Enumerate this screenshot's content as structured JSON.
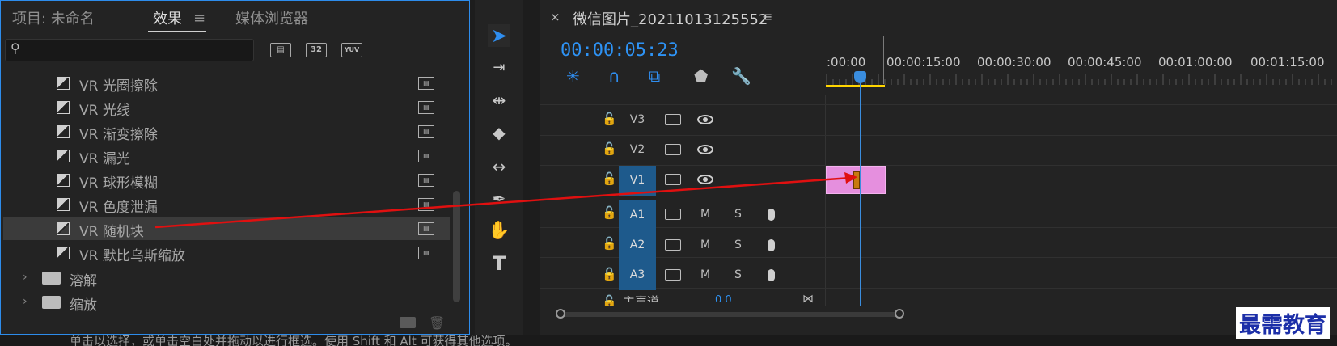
{
  "effects_panel": {
    "tabs": [
      {
        "label": "项目: 未命名"
      },
      {
        "label": "效果"
      },
      {
        "label": "媒体浏览器"
      }
    ],
    "menu_icon": "hamburger-icon",
    "toolbar_badges": [
      "32",
      "YUV"
    ],
    "search": {
      "value": "",
      "placeholder": ""
    },
    "items": [
      {
        "label": "VR 光圈擦除",
        "kind": "effect"
      },
      {
        "label": "VR 光线",
        "kind": "effect"
      },
      {
        "label": "VR 渐变擦除",
        "kind": "effect"
      },
      {
        "label": "VR 漏光",
        "kind": "effect"
      },
      {
        "label": "VR 球形模糊",
        "kind": "effect"
      },
      {
        "label": "VR 色度泄漏",
        "kind": "effect"
      },
      {
        "label": "VR 随机块",
        "kind": "effect",
        "selected": true
      },
      {
        "label": "VR 默比乌斯缩放",
        "kind": "effect"
      },
      {
        "label": "溶解",
        "kind": "folder"
      },
      {
        "label": "缩放",
        "kind": "folder"
      }
    ]
  },
  "tools": [
    "selection-tool",
    "track-select-tool",
    "ripple-edit-tool",
    "razor-tool",
    "slip-tool",
    "pen-tool",
    "hand-tool",
    "type-tool"
  ],
  "timeline": {
    "title": "微信图片_20211013125552",
    "close_label": "×",
    "menu_label": "≡",
    "timecode": "00:00:05:23",
    "ruler_labels": [
      ":00:00",
      "00:00:15:00",
      "00:00:30:00",
      "00:00:45:00",
      "00:01:00:00",
      "00:01:15:00"
    ],
    "video_tracks": [
      "V3",
      "V2",
      "V1"
    ],
    "audio_tracks": [
      "A1",
      "A2",
      "A3"
    ],
    "mute_label": "M",
    "solo_label": "S",
    "master_track": {
      "label": "主声道",
      "value": "0.0"
    }
  },
  "status_text": "单击以选择，或单击空白处并拖动以进行框选。使用 Shift 和 Alt 可获得其他选项。",
  "brand": "最需教育",
  "colors": {
    "accent": "#2e93f5",
    "clip": "#e58fde",
    "work_area": "#ffd500",
    "annotation_arrow": "#e01010",
    "brand": "#1c2fa8"
  }
}
